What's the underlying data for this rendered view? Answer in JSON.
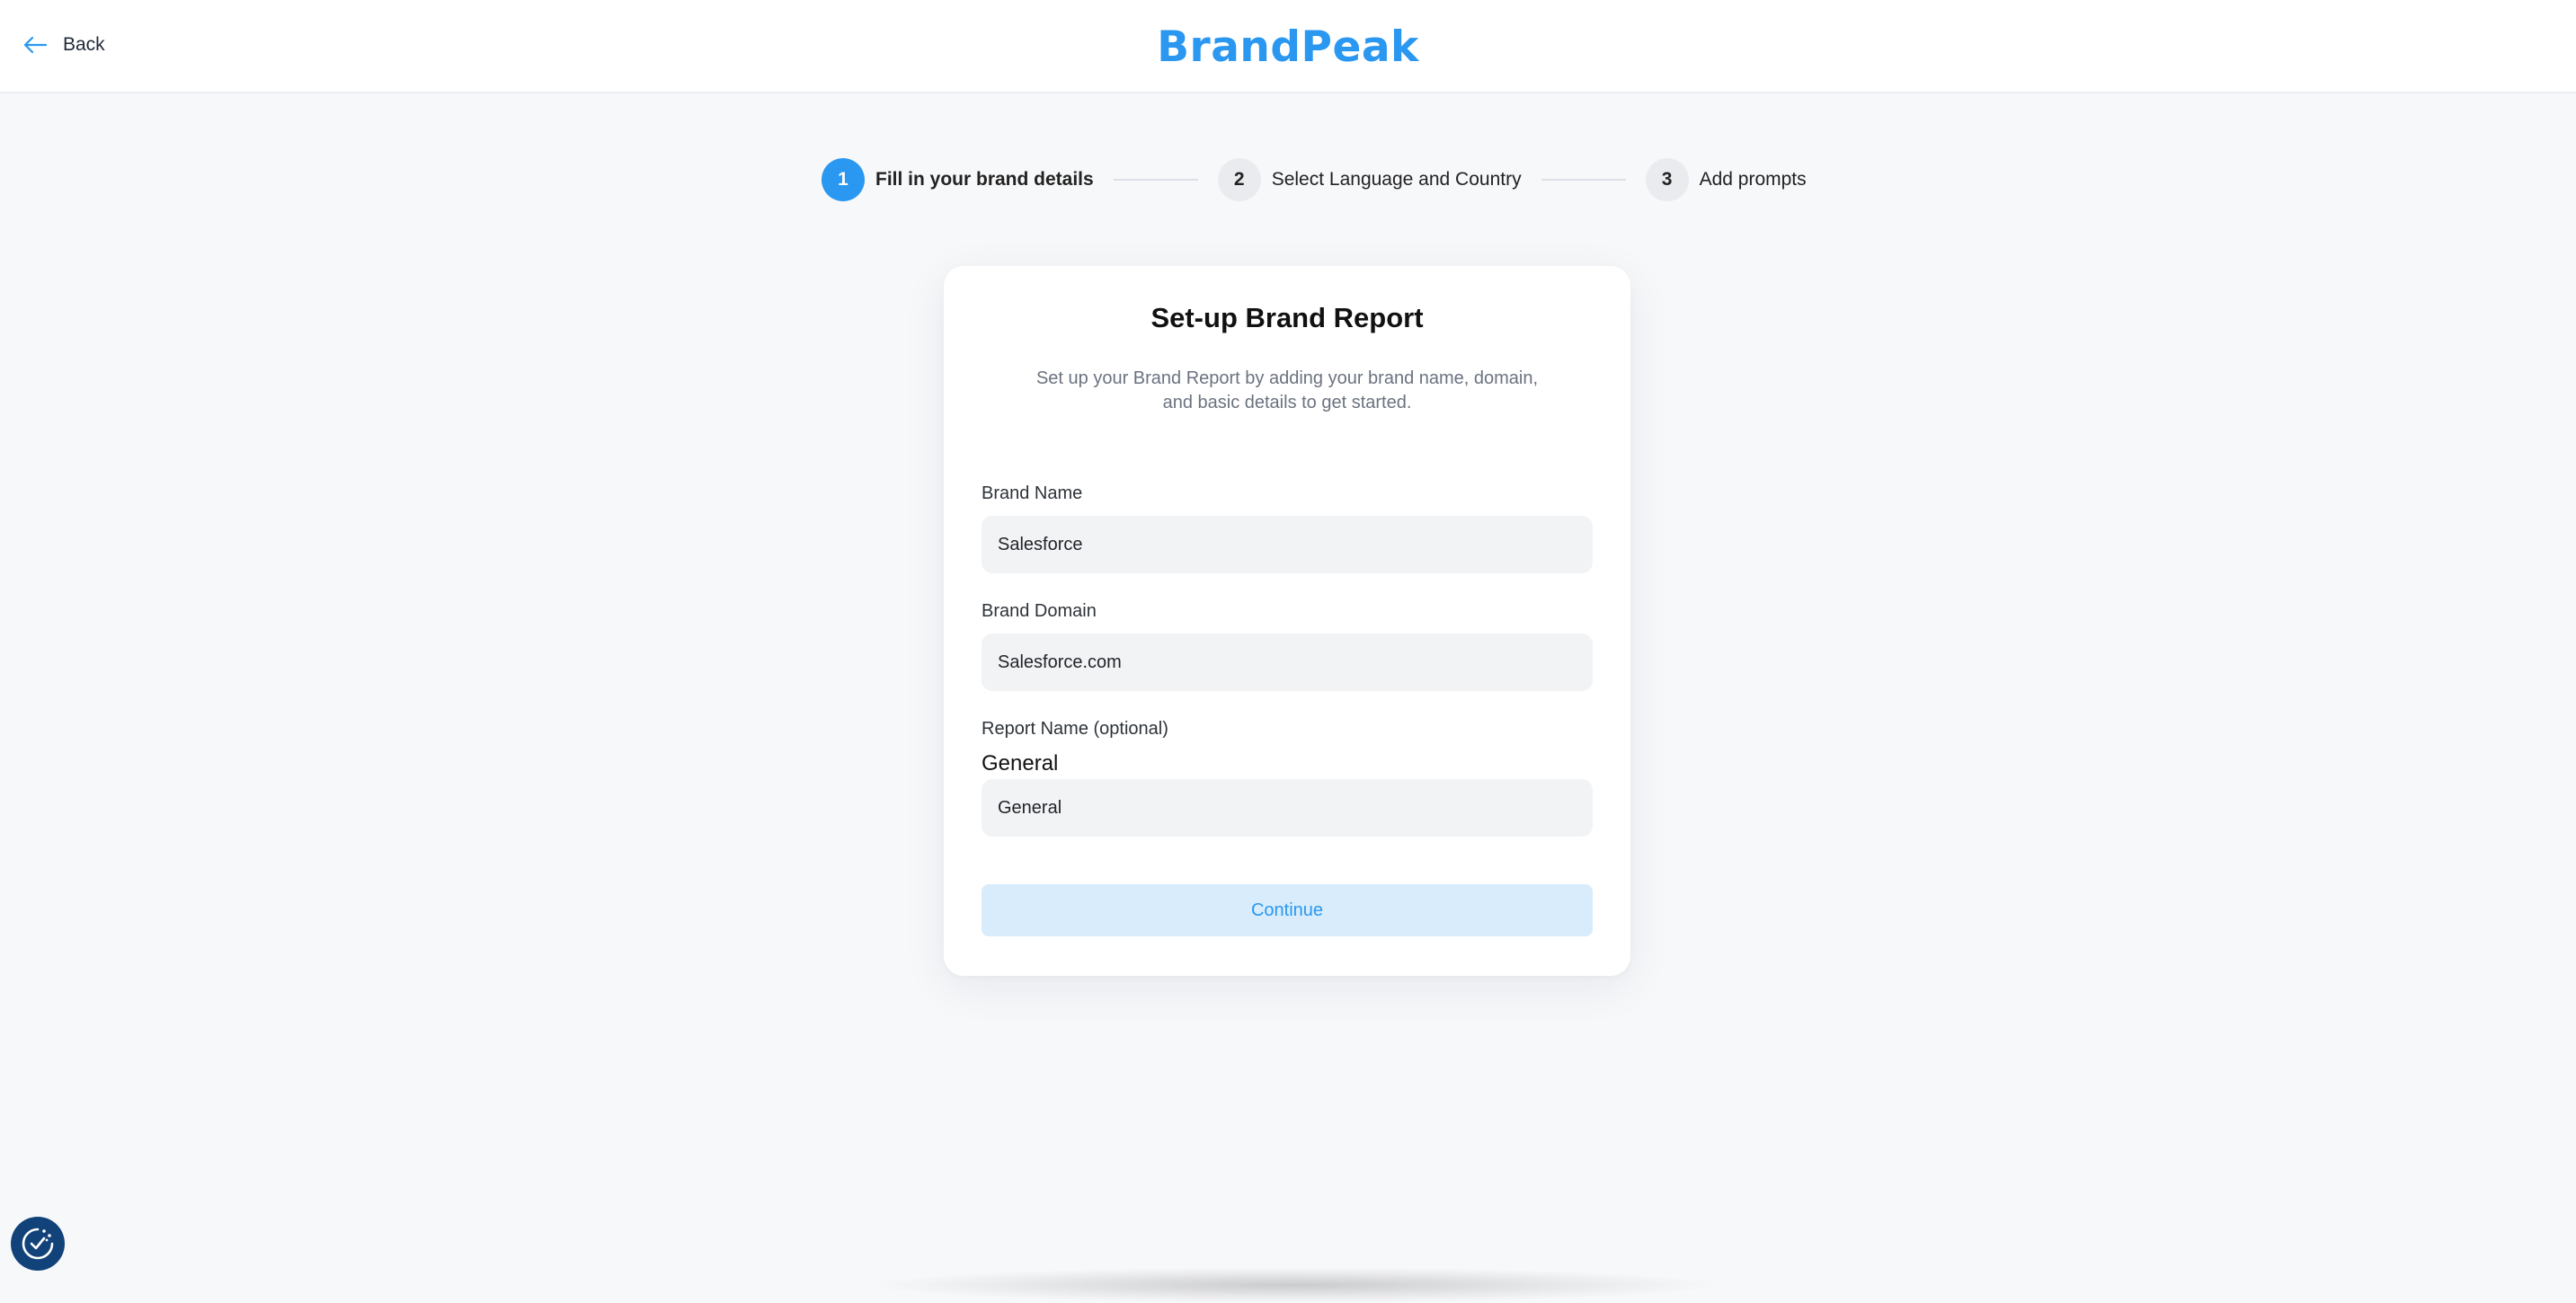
{
  "header": {
    "back_label": "Back",
    "logo_text": "BrandPeak"
  },
  "stepper": {
    "steps": [
      {
        "number": "1",
        "label": "Fill in your brand details",
        "active": true
      },
      {
        "number": "2",
        "label": "Select Language and Country",
        "active": false
      },
      {
        "number": "3",
        "label": "Add prompts",
        "active": false
      }
    ]
  },
  "form": {
    "title": "Set-up Brand Report",
    "subtitle_line1": "Set up your Brand Report by adding your brand name, domain,",
    "subtitle_line2": "and basic details to get started.",
    "brand_name": {
      "label": "Brand Name",
      "value": "Salesforce"
    },
    "brand_domain": {
      "label": "Brand Domain",
      "value": "Salesforce.com"
    },
    "report_name": {
      "label": "Report Name (optional)",
      "echo": "General",
      "value": "General"
    },
    "continue_label": "Continue"
  },
  "colors": {
    "brand": "#2a97f0",
    "background": "#f7f8fa",
    "input_bg": "#f2f3f5",
    "button_disabled_bg": "#d8ecfc",
    "cookie_button": "#11427a"
  },
  "icons": {
    "back": "arrow-left-icon",
    "cookie": "cookie-consent-icon"
  }
}
